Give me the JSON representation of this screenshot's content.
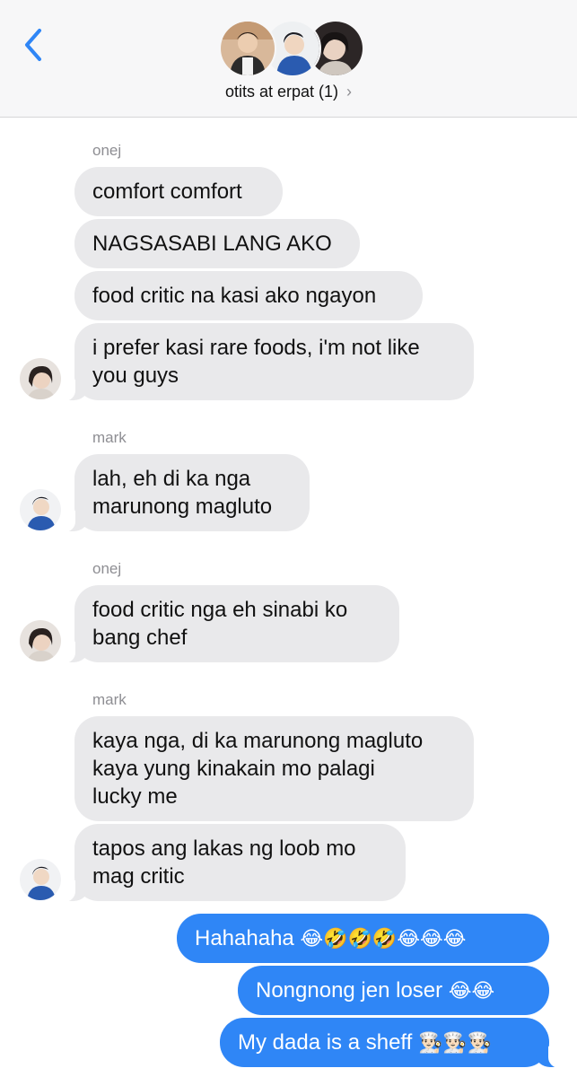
{
  "header": {
    "group_name": "otits at erpat",
    "unread": "(1)",
    "chevron": "›"
  },
  "icons": {
    "back": "chevron-left-icon",
    "accent": "#2f86f6"
  },
  "messages": {
    "s1": "onej",
    "m1": "comfort comfort",
    "m2": "NAGSASABI LANG AKO",
    "m3": "food critic na kasi ako ngayon",
    "m4a": "i prefer kasi rare foods, i'm not like",
    "m4b": "you guys",
    "s2": "mark",
    "m5a": "lah, eh di ka nga",
    "m5b": "marunong magluto",
    "s3": "onej",
    "m6a": "food critic nga eh sinabi ko",
    "m6b": "bang chef",
    "s4": "mark",
    "m7a": "kaya nga, di ka marunong magluto",
    "m7b": "kaya yung kinakain mo palagi",
    "m7c": "lucky me",
    "m8a": "tapos ang lakas ng loob mo",
    "m8b": "mag critic",
    "o1_text": "Hahahaha ",
    "o1_emoji": "😂🤣🤣🤣😂😂😂",
    "o2_text": "Nongnong jen loser ",
    "o2_emoji": "😂😂",
    "o3_text": "My dada is a sheff ",
    "o3_emoji": "👨🏻‍🍳👨🏻‍🍳👨🏻‍🍳"
  }
}
